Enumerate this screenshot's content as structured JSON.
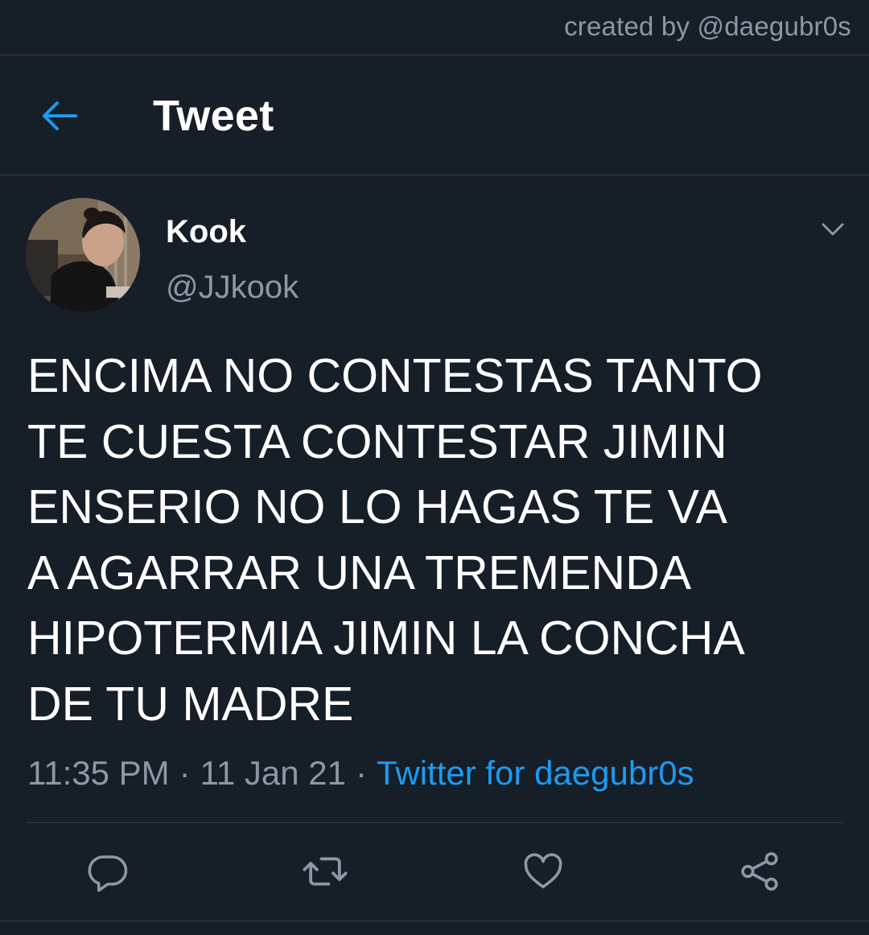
{
  "watermark": "created by @daegubr0s",
  "header": {
    "title": "Tweet",
    "back_icon": "arrow-left-icon"
  },
  "tweet": {
    "author": {
      "display_name": "Kook",
      "handle": "@JJkook",
      "avatar_icon": "profile-photo"
    },
    "text": "ENCIMA NO CONTESTAS TANTO\nTE CUESTA CONTESTAR JIMIN\nENSERIO NO LO HAGAS TE VA\nA AGARRAR UNA TREMENDA\nHIPOTERMIA JIMIN LA CONCHA\nDE TU MADRE",
    "time": "11:35 PM",
    "date": "11 Jan 21",
    "separator": "·",
    "source": "Twitter for daegubr0s"
  },
  "actions": {
    "reply_icon": "reply-icon",
    "retweet_icon": "retweet-icon",
    "like_icon": "heart-icon",
    "share_icon": "share-icon"
  },
  "colors": {
    "background": "#161e28",
    "text": "#ffffff",
    "muted": "#8b98a5",
    "accent": "#1d9bf0",
    "border": "#2f3b48"
  }
}
